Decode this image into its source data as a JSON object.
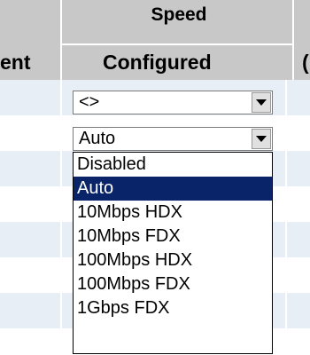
{
  "header": {
    "group_label": "Speed",
    "left_column_partial": "ent",
    "configured_label": "Configured",
    "right_column_partial": "("
  },
  "rows": [
    {
      "selected": "<>"
    },
    {
      "selected": "Auto"
    }
  ],
  "dropdown": {
    "options": [
      "Disabled",
      "Auto",
      "10Mbps HDX",
      "10Mbps FDX",
      "100Mbps HDX",
      "100Mbps FDX",
      "1Gbps FDX"
    ],
    "highlighted": "Auto"
  },
  "colors": {
    "header_bg": "#c8c8c8",
    "stripe_bg": "#e8eef6",
    "highlight_bg": "#0a246a"
  }
}
